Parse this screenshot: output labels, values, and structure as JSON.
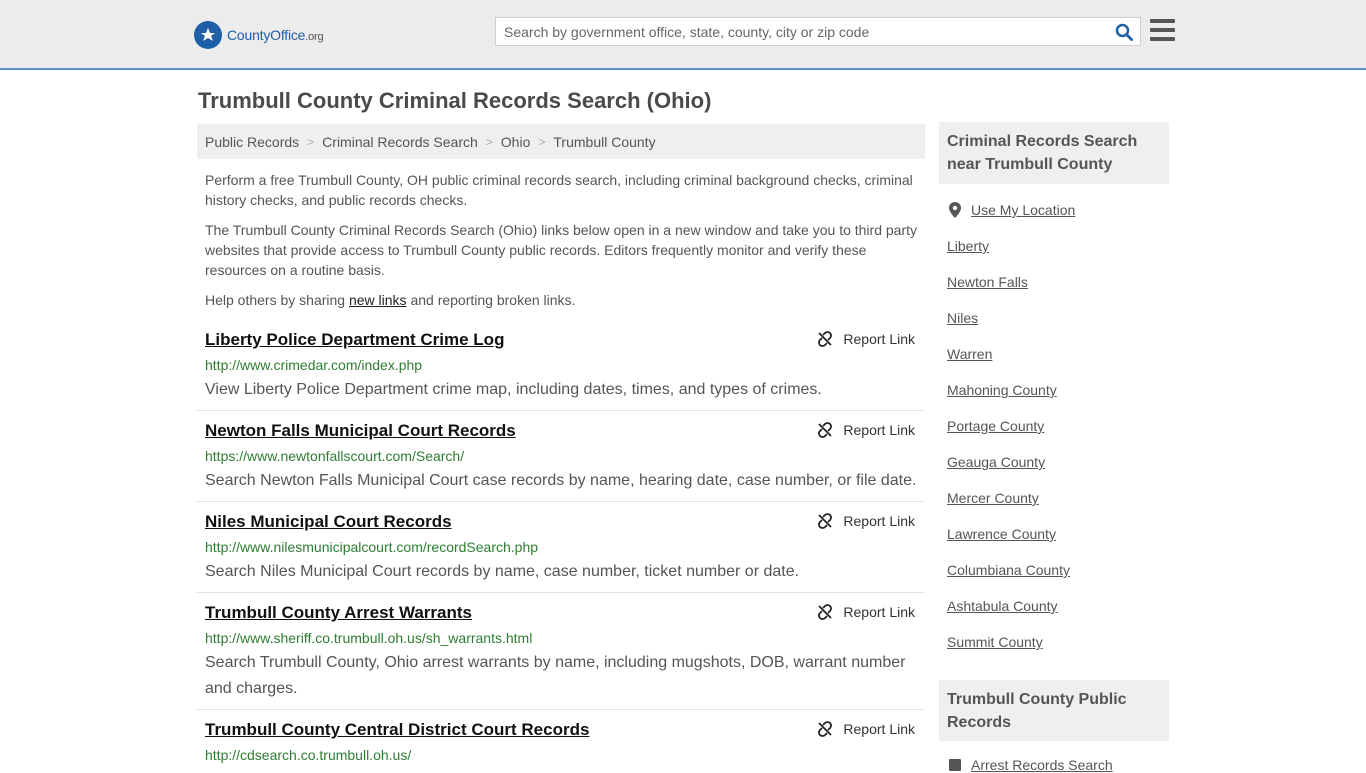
{
  "header": {
    "logo_text": "CountyOffice",
    "logo_org": ".org",
    "search_placeholder": "Search by government office, state, county, city or zip code"
  },
  "page": {
    "title": "Trumbull County Criminal Records Search (Ohio)"
  },
  "breadcrumb": [
    "Public Records",
    "Criminal Records Search",
    "Ohio",
    "Trumbull County"
  ],
  "intro": {
    "p1": "Perform a free Trumbull County, OH public criminal records search, including criminal background checks, criminal history checks, and public records checks.",
    "p2": "The Trumbull County Criminal Records Search (Ohio) links below open in a new window and take you to third party websites that provide access to Trumbull County public records. Editors frequently monitor and verify these resources on a routine basis.",
    "p3_before": "Help others by sharing ",
    "p3_link": "new links",
    "p3_after": " and reporting broken links."
  },
  "report_label": "Report Link",
  "results": [
    {
      "title": "Liberty Police Department Crime Log",
      "url": "http://www.crimedar.com/index.php",
      "desc": "View Liberty Police Department crime map, including dates, times, and types of crimes."
    },
    {
      "title": "Newton Falls Municipal Court Records",
      "url": "https://www.newtonfallscourt.com/Search/",
      "desc": "Search Newton Falls Municipal Court case records by name, hearing date, case number, or file date."
    },
    {
      "title": "Niles Municipal Court Records",
      "url": "http://www.nilesmunicipalcourt.com/recordSearch.php",
      "desc": "Search Niles Municipal Court records by name, case number, ticket number or date."
    },
    {
      "title": "Trumbull County Arrest Warrants",
      "url": "http://www.sheriff.co.trumbull.oh.us/sh_warrants.html",
      "desc": "Search Trumbull County, Ohio arrest warrants by name, including mugshots, DOB, warrant number and charges."
    },
    {
      "title": "Trumbull County Central District Court Records",
      "url": "http://cdsearch.co.trumbull.oh.us/",
      "desc": ""
    }
  ],
  "sidebar": {
    "nearby_title": "Criminal Records Search near Trumbull County",
    "use_location": "Use My Location",
    "nearby": [
      "Liberty",
      "Newton Falls",
      "Niles",
      "Warren",
      "Mahoning County",
      "Portage County",
      "Geauga County",
      "Mercer County",
      "Lawrence County",
      "Columbiana County",
      "Ashtabula County",
      "Summit County"
    ],
    "public_title": "Trumbull County Public Records",
    "public_first": "Arrest Records Search"
  },
  "colors": {
    "accent": "#1f5fa8",
    "url_green": "#2f7d32",
    "header_bg": "#ececec"
  }
}
